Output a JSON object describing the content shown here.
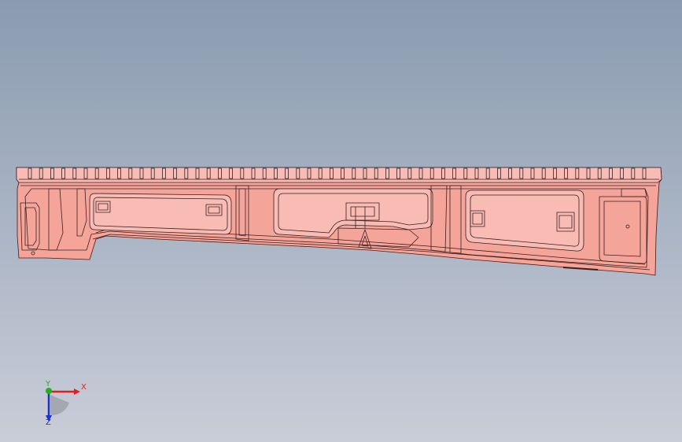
{
  "viewport": {
    "background_top": "#8a9bb0",
    "background_bottom": "#c9cdd8"
  },
  "model": {
    "fill": "#f5a49a",
    "fill_light": "#f8bcb4",
    "edge": "#3a1f1f"
  },
  "triad": {
    "x_label": "X",
    "y_label": "Y",
    "z_label": "Z",
    "x_color": "#e02020",
    "y_color": "#20b020",
    "z_color": "#2030d0"
  }
}
